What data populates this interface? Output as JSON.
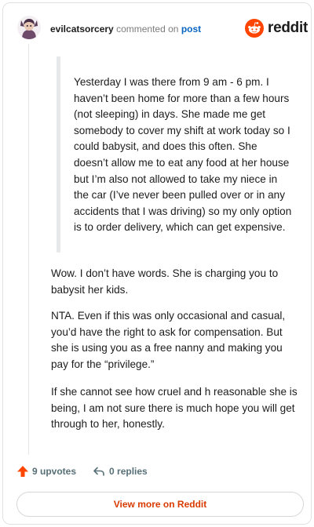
{
  "header": {
    "username": "evilcatsorcery",
    "commented_on": "commented on",
    "post_link": "post",
    "brand": "reddit"
  },
  "comment": {
    "quote": "Yesterday I was there from 9 am - 6 pm. I haven’t been home for more than a few hours (not sleeping) in days. She made me get somebody to cover my shift at work today so I could babysit, and does this often. She doesn’t allow me to eat any food at her house but I’m also not allowed to take my niece in the car (I’ve never been pulled over or in any accidents that I was driving) so my only option is to order delivery, which can get expensive.",
    "paragraphs": [
      "Wow. I don’t have words. She is charging you to babysit her kids.",
      "NTA. Even if this was only occasional and casual, you’d have the right to ask for compensation. But she is using you as a free nanny and making you pay for the “privilege.”",
      "If she cannot see how cruel and h reasonable she is being, I am not sure there is much hope you will get through to her, honestly."
    ]
  },
  "footer": {
    "upvotes": "9 upvotes",
    "replies": "0 replies",
    "view_more": "View more on Reddit"
  },
  "colors": {
    "accent": "#d93a00",
    "reddit_orange": "#ff4500",
    "link_blue": "#0a65c2",
    "muted": "#576f76"
  },
  "icons": [
    "avatar",
    "reddit-logo-icon",
    "upvote-arrow-icon",
    "reply-arrow-icon"
  ]
}
